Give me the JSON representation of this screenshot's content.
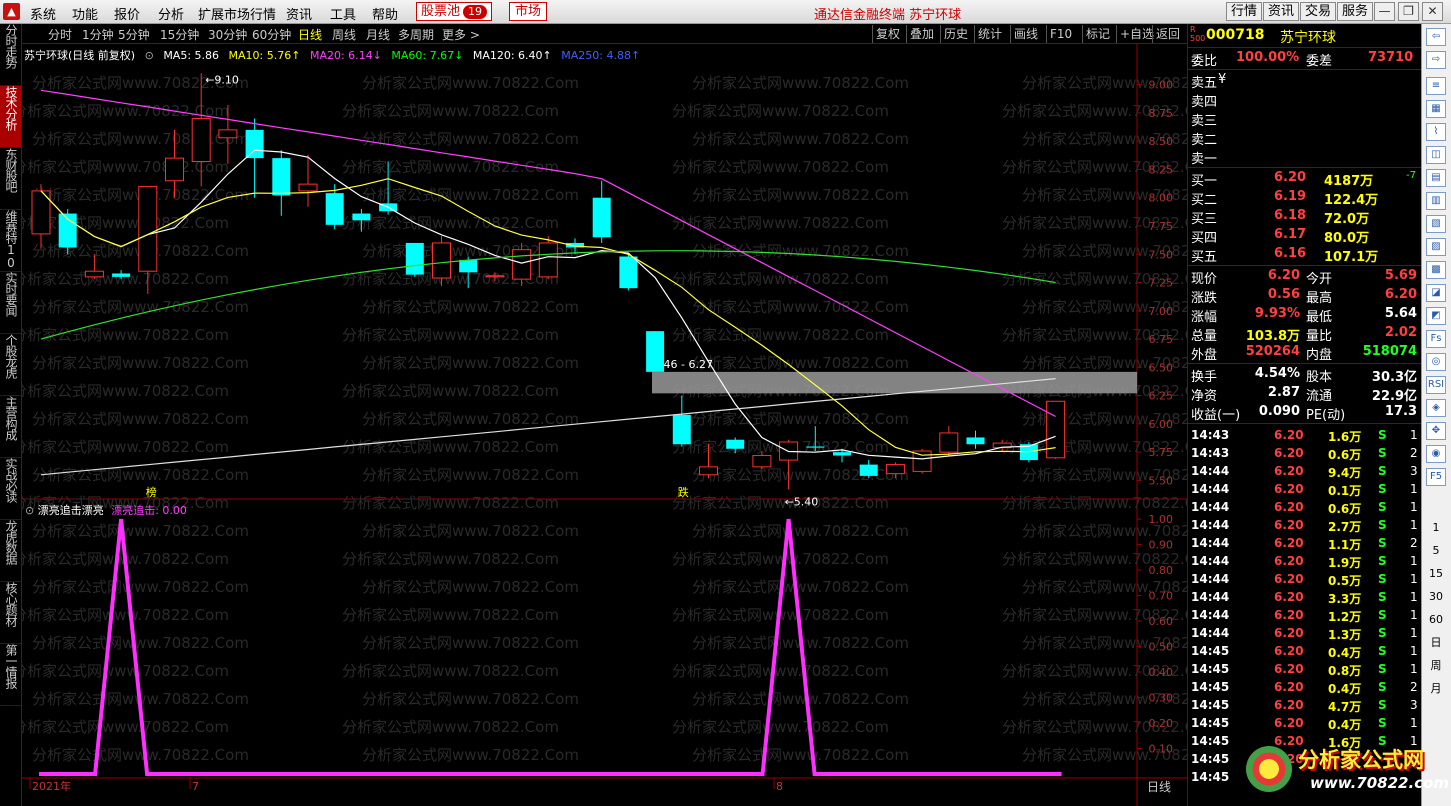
{
  "menu": {
    "items": [
      "系统",
      "功能",
      "报价",
      "分析",
      "扩展市场行情",
      "资讯",
      "工具",
      "帮助"
    ],
    "pool_label": "股票池",
    "pool_count": "19",
    "market_label": "市场",
    "center_title": "通达信金融终端  苏宁环球",
    "right_buttons": [
      "行情",
      "资讯",
      "交易",
      "服务"
    ]
  },
  "left_tabs": [
    {
      "label": "分时走势",
      "active": false
    },
    {
      "label": "技术分析",
      "active": true
    },
    {
      "label": "东财股吧",
      "active": false
    },
    {
      "label": "维赛特10",
      "active": false
    },
    {
      "label": "实时要闻",
      "active": false
    },
    {
      "label": "个股龙虎",
      "active": false
    },
    {
      "label": "主营构成",
      "active": false
    },
    {
      "label": "实战必读",
      "active": false
    },
    {
      "label": "龙虎数据",
      "active": false
    },
    {
      "label": "核心题材",
      "active": false
    },
    {
      "label": "第一情报",
      "active": false
    }
  ],
  "periods": [
    "分时",
    "1分钟",
    "5分钟",
    "15分钟",
    "30分钟",
    "60分钟",
    "日线",
    "周线",
    "月线",
    "多周期",
    "更多 >"
  ],
  "active_period": "日线",
  "tool_buttons": [
    "复权",
    "叠加",
    "历史",
    "统计",
    "画线",
    "F10",
    "标记",
    "+自选",
    "返回"
  ],
  "chart": {
    "title": "苏宁环球(日线 前复权)",
    "ma": [
      {
        "label": "MA5: 5.86",
        "color": "#ffffff"
      },
      {
        "label": "MA10: 5.76↑",
        "color": "#ffff00"
      },
      {
        "label": "MA20: 6.14↓",
        "color": "#ff40ff"
      },
      {
        "label": "MA60: 7.67↓",
        "color": "#00ff00"
      },
      {
        "label": "MA120: 6.40↑",
        "color": "#ffffff"
      },
      {
        "label": "MA250: 4.88↑",
        "color": "#4060ff"
      }
    ],
    "high_label": "9.10",
    "low_label": "5.40",
    "gap_label": "6.46 - 6.27",
    "marker_bang": "榜",
    "marker_die": "跌",
    "watermark": "分析家公式网www.70822.Com",
    "indicator_title": "漂亮追击漂亮",
    "indicator_value": "漂亮追击: 0.00",
    "x_labels": [
      "2021年",
      "7",
      "8"
    ],
    "period_corner": "日线"
  },
  "chart_data": {
    "type": "candlestick",
    "price_axis": [
      9.0,
      8.75,
      8.5,
      8.25,
      8.0,
      7.75,
      7.5,
      7.25,
      7.0,
      6.75,
      6.5,
      6.25,
      6.0,
      5.75,
      5.5
    ],
    "candles": [
      {
        "o": 7.68,
        "c": 8.06,
        "h": 8.12,
        "l": 7.55
      },
      {
        "o": 7.86,
        "c": 7.56,
        "h": 7.9,
        "l": 7.5
      },
      {
        "o": 7.3,
        "c": 7.35,
        "h": 7.5,
        "l": 7.28
      },
      {
        "o": 7.33,
        "c": 7.3,
        "h": 7.36,
        "l": 7.28
      },
      {
        "o": 7.35,
        "c": 8.1,
        "h": 8.1,
        "l": 7.15
      },
      {
        "o": 8.15,
        "c": 8.35,
        "h": 8.6,
        "l": 8.0
      },
      {
        "o": 8.32,
        "c": 8.7,
        "h": 9.1,
        "l": 8.1
      },
      {
        "o": 8.53,
        "c": 8.6,
        "h": 8.82,
        "l": 8.3
      },
      {
        "o": 8.6,
        "c": 8.35,
        "h": 8.7,
        "l": 8.0
      },
      {
        "o": 8.35,
        "c": 8.02,
        "h": 8.42,
        "l": 7.84
      },
      {
        "o": 8.06,
        "c": 8.12,
        "h": 8.38,
        "l": 7.92
      },
      {
        "o": 8.04,
        "c": 7.76,
        "h": 8.12,
        "l": 7.72
      },
      {
        "o": 7.86,
        "c": 7.8,
        "h": 7.9,
        "l": 7.7
      },
      {
        "o": 7.95,
        "c": 7.88,
        "h": 8.32,
        "l": 7.85
      },
      {
        "o": 7.6,
        "c": 7.32,
        "h": 7.6,
        "l": 7.3
      },
      {
        "o": 7.29,
        "c": 7.6,
        "h": 7.66,
        "l": 7.22
      },
      {
        "o": 7.45,
        "c": 7.34,
        "h": 7.48,
        "l": 7.2
      },
      {
        "o": 7.3,
        "c": 7.31,
        "h": 7.34,
        "l": 7.26
      },
      {
        "o": 7.28,
        "c": 7.54,
        "h": 7.6,
        "l": 7.22
      },
      {
        "o": 7.3,
        "c": 7.6,
        "h": 7.66,
        "l": 7.28
      },
      {
        "o": 7.6,
        "c": 7.56,
        "h": 7.64,
        "l": 7.5
      },
      {
        "o": 8.0,
        "c": 7.65,
        "h": 8.15,
        "l": 7.6
      },
      {
        "o": 7.48,
        "c": 7.2,
        "h": 7.5,
        "l": 7.18
      },
      {
        "o": 6.82,
        "c": 6.46,
        "h": 6.82,
        "l": 6.46
      },
      {
        "o": 6.08,
        "c": 5.82,
        "h": 6.25,
        "l": 5.8
      },
      {
        "o": 5.55,
        "c": 5.62,
        "h": 5.82,
        "l": 5.52
      },
      {
        "o": 5.86,
        "c": 5.78,
        "h": 5.88,
        "l": 5.74
      },
      {
        "o": 5.62,
        "c": 5.72,
        "h": 5.76,
        "l": 5.6
      },
      {
        "o": 5.68,
        "c": 5.84,
        "h": 5.86,
        "l": 5.42
      },
      {
        "o": 5.8,
        "c": 5.79,
        "h": 5.98,
        "l": 5.76
      },
      {
        "o": 5.75,
        "c": 5.72,
        "h": 5.78,
        "l": 5.66
      },
      {
        "o": 5.64,
        "c": 5.54,
        "h": 5.68,
        "l": 5.52
      },
      {
        "o": 5.56,
        "c": 5.64,
        "h": 5.66,
        "l": 5.52
      },
      {
        "o": 5.58,
        "c": 5.76,
        "h": 5.78,
        "l": 5.56
      },
      {
        "o": 5.75,
        "c": 5.92,
        "h": 5.98,
        "l": 5.72
      },
      {
        "o": 5.88,
        "c": 5.82,
        "h": 5.94,
        "l": 5.78
      },
      {
        "o": 5.79,
        "c": 5.83,
        "h": 5.86,
        "l": 5.75
      },
      {
        "o": 5.82,
        "c": 5.68,
        "h": 5.84,
        "l": 5.66
      },
      {
        "o": 5.7,
        "c": 6.2,
        "h": 6.2,
        "l": 5.69
      }
    ],
    "indicator": {
      "name": "漂亮追击",
      "axis": [
        1.0,
        0.9,
        0.8,
        0.7,
        0.6,
        0.5,
        0.4,
        0.3,
        0.2,
        0.1
      ],
      "spikes": [
        3,
        28
      ]
    }
  },
  "quote": {
    "code": "000718",
    "name": "苏宁环球",
    "weibi": {
      "label": "委比",
      "value": "100.00%",
      "label2": "委差",
      "value2": "73710"
    },
    "sell": [
      {
        "label": "卖五",
        "price": "",
        "vol": "",
        "extra": "¥"
      },
      {
        "label": "卖四",
        "price": "",
        "vol": ""
      },
      {
        "label": "卖三",
        "price": "",
        "vol": ""
      },
      {
        "label": "卖二",
        "price": "",
        "vol": ""
      },
      {
        "label": "卖一",
        "price": "",
        "vol": ""
      }
    ],
    "buy": [
      {
        "label": "买一",
        "price": "6.20",
        "vol": "4187万",
        "chg": "-7"
      },
      {
        "label": "买二",
        "price": "6.19",
        "vol": "122.4万"
      },
      {
        "label": "买三",
        "price": "6.18",
        "vol": "72.0万"
      },
      {
        "label": "买四",
        "price": "6.17",
        "vol": "80.0万"
      },
      {
        "label": "买五",
        "price": "6.16",
        "vol": "107.1万"
      }
    ],
    "stats": [
      {
        "l1": "现价",
        "v1": "6.20",
        "c1": "red",
        "l2": "今开",
        "v2": "5.69",
        "c2": "red"
      },
      {
        "l1": "涨跌",
        "v1": "0.56",
        "c1": "red",
        "l2": "最高",
        "v2": "6.20",
        "c2": "red"
      },
      {
        "l1": "涨幅",
        "v1": "9.93%",
        "c1": "red",
        "l2": "最低",
        "v2": "5.64",
        "c2": "white"
      },
      {
        "l1": "总量",
        "v1": "103.8万",
        "c1": "yellow",
        "l2": "量比",
        "v2": "2.02",
        "c2": "red"
      },
      {
        "l1": "外盘",
        "v1": "520264",
        "c1": "red",
        "l2": "内盘",
        "v2": "518074",
        "c2": "green"
      }
    ],
    "stats2": [
      {
        "l1": "换手",
        "v1": "4.54%",
        "c1": "white",
        "l2": "股本",
        "v2": "30.3亿",
        "c2": "white"
      },
      {
        "l1": "净资",
        "v1": "2.87",
        "c1": "white",
        "l2": "流通",
        "v2": "22.9亿",
        "c2": "white"
      },
      {
        "l1": "收益(一)",
        "v1": "0.090",
        "c1": "white",
        "l2": "PE(动)",
        "v2": "17.3",
        "c2": "white"
      }
    ],
    "ticks": [
      {
        "t": "14:43",
        "p": "6.20",
        "v": "1.6万",
        "s": "S",
        "n": "1"
      },
      {
        "t": "14:43",
        "p": "6.20",
        "v": "0.6万",
        "s": "S",
        "n": "2"
      },
      {
        "t": "14:44",
        "p": "6.20",
        "v": "9.4万",
        "s": "S",
        "n": "3"
      },
      {
        "t": "14:44",
        "p": "6.20",
        "v": "0.1万",
        "s": "S",
        "n": "1"
      },
      {
        "t": "14:44",
        "p": "6.20",
        "v": "0.6万",
        "s": "S",
        "n": "1"
      },
      {
        "t": "14:44",
        "p": "6.20",
        "v": "2.7万",
        "s": "S",
        "n": "1"
      },
      {
        "t": "14:44",
        "p": "6.20",
        "v": "1.1万",
        "s": "S",
        "n": "2"
      },
      {
        "t": "14:44",
        "p": "6.20",
        "v": "1.9万",
        "s": "S",
        "n": "1"
      },
      {
        "t": "14:44",
        "p": "6.20",
        "v": "0.5万",
        "s": "S",
        "n": "1"
      },
      {
        "t": "14:44",
        "p": "6.20",
        "v": "3.3万",
        "s": "S",
        "n": "1"
      },
      {
        "t": "14:44",
        "p": "6.20",
        "v": "1.2万",
        "s": "S",
        "n": "1"
      },
      {
        "t": "14:44",
        "p": "6.20",
        "v": "1.3万",
        "s": "S",
        "n": "1"
      },
      {
        "t": "14:45",
        "p": "6.20",
        "v": "0.4万",
        "s": "S",
        "n": "1"
      },
      {
        "t": "14:45",
        "p": "6.20",
        "v": "0.8万",
        "s": "S",
        "n": "1"
      },
      {
        "t": "14:45",
        "p": "6.20",
        "v": "0.4万",
        "s": "S",
        "n": "2"
      },
      {
        "t": "14:45",
        "p": "6.20",
        "v": "4.7万",
        "s": "S",
        "n": "3"
      },
      {
        "t": "14:45",
        "p": "6.20",
        "v": "0.4万",
        "s": "S",
        "n": "1"
      },
      {
        "t": "14:45",
        "p": "6.20",
        "v": "1.6万",
        "s": "S",
        "n": "1"
      },
      {
        "t": "14:45",
        "p": "6.20",
        "v": "",
        "s": "",
        "n": ""
      },
      {
        "t": "14:45",
        "p": "",
        "v": "",
        "s": "",
        "n": ""
      }
    ]
  },
  "side_icons": [
    "⇦",
    "⇨",
    "≡",
    "▦",
    "⌇",
    "◫",
    "▤",
    "▥",
    "▧",
    "▨",
    "▩",
    "◪",
    "◩",
    "Fs",
    "◎",
    "RSI",
    "◈",
    "✥",
    "◉",
    "F5"
  ],
  "side_numbers": [
    "1",
    "5",
    "15",
    "30",
    "60",
    "日",
    "周",
    "月"
  ],
  "brand": {
    "name": "分析家公式网",
    "url": "www.70822.com"
  }
}
